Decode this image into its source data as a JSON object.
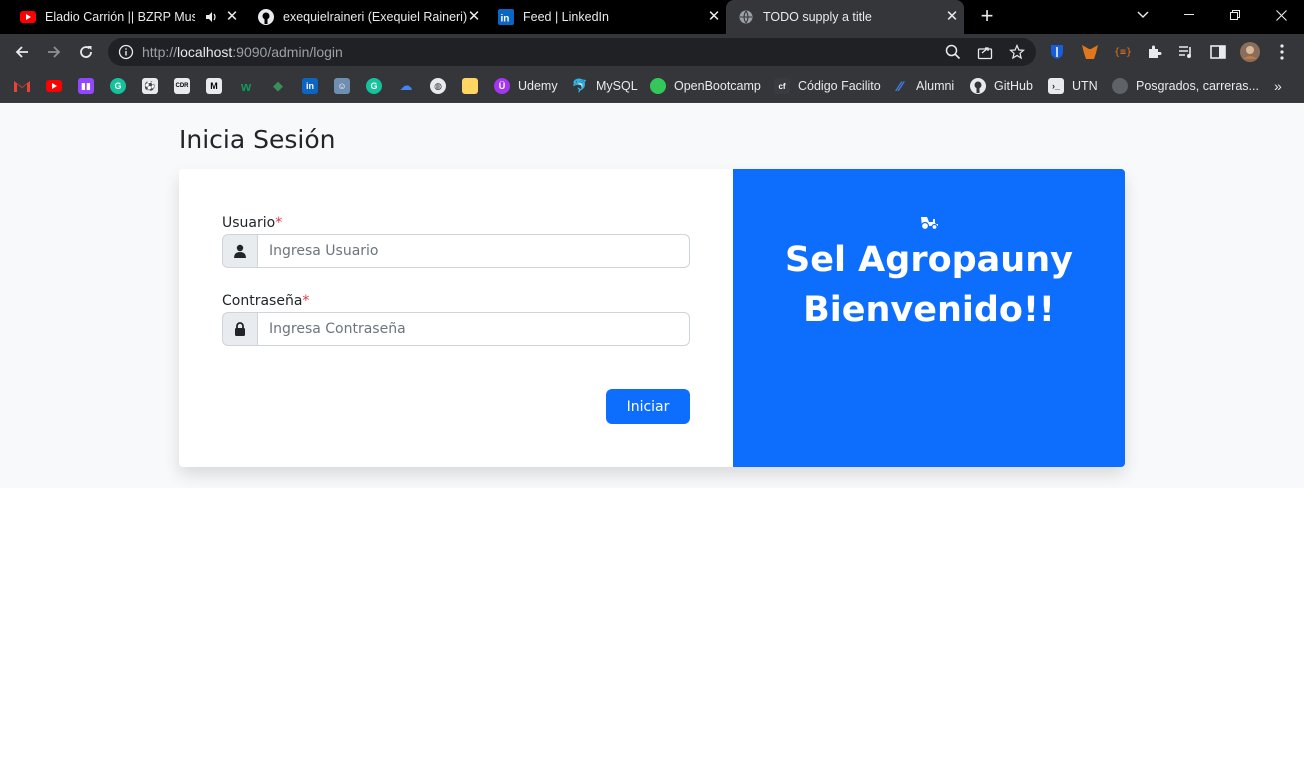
{
  "browser": {
    "tabs": [
      {
        "title": "Eladio Carrión || BZRP Music",
        "icon": "youtube-icon",
        "audio": true,
        "active": false
      },
      {
        "title": "exequielraineri (Exequiel Raineri)",
        "icon": "github-icon",
        "active": false
      },
      {
        "title": "Feed | LinkedIn",
        "icon": "linkedin-icon",
        "active": false
      },
      {
        "title": "TODO supply a title",
        "icon": "globe-icon",
        "active": true
      }
    ],
    "url_prefix": "http://",
    "url_host": "localhost",
    "url_rest": ":9090/admin/login",
    "bookmarks": [
      {
        "label": "",
        "icon": "gmail-icon",
        "color": "#ea4335"
      },
      {
        "label": "",
        "icon": "youtube-icon",
        "color": "#ff0000"
      },
      {
        "label": "",
        "icon": "twitch-icon",
        "color": "#9146ff"
      },
      {
        "label": "",
        "icon": "grammarly-icon",
        "color": "#15c39a"
      },
      {
        "label": "",
        "icon": "soccer-icon",
        "color": "#9aa0a6"
      },
      {
        "label": "",
        "icon": "coder-icon",
        "color": "#222222"
      },
      {
        "label": "",
        "icon": "medium-icon",
        "color": "#111111"
      },
      {
        "label": "",
        "icon": "w-icon",
        "color": "#0f9d58"
      },
      {
        "label": "",
        "icon": "ethereum-icon",
        "color": "#3c8c5c"
      },
      {
        "label": "",
        "icon": "linkedin-icon",
        "color": "#0a66c2"
      },
      {
        "label": "",
        "icon": "profile-icon",
        "color": "#6f8fb0"
      },
      {
        "label": "",
        "icon": "grammarly-icon",
        "color": "#15c39a"
      },
      {
        "label": "",
        "icon": "cloud-icon",
        "color": "#4285f4"
      },
      {
        "label": "",
        "icon": "globe-icon",
        "color": "#bdc1c6"
      },
      {
        "label": "",
        "icon": "note-icon",
        "color": "#fdd663"
      },
      {
        "label": "Udemy",
        "icon": "udemy-icon",
        "color": "#a435f0"
      },
      {
        "label": "MySQL",
        "icon": "mysql-icon",
        "color": "#4479a1"
      },
      {
        "label": "OpenBootcamp",
        "icon": "openbootcamp-icon",
        "color": "#34c759"
      },
      {
        "label": "Código Facilito",
        "icon": "codigofacilito-icon",
        "color": "#3a3b40"
      },
      {
        "label": "Alumni",
        "icon": "alumni-icon",
        "color": "#4285f4"
      },
      {
        "label": "GitHub",
        "icon": "github-icon",
        "color": "#ffffff"
      },
      {
        "label": "UTN",
        "icon": "terminal-icon",
        "color": "#202124"
      },
      {
        "label": "Posgrados, carreras...",
        "icon": "circle-icon",
        "color": "#5f6368"
      }
    ]
  },
  "page": {
    "heading": "Inicia Sesión",
    "user_label": "Usuario",
    "user_placeholder": "Ingresa Usuario",
    "password_label": "Contraseña",
    "password_placeholder": "Ingresa Contraseña",
    "required_mark": "*",
    "submit_label": "Iniciar",
    "brand_line1": "Sel Agropauny",
    "brand_line2": "Bienvenido!!",
    "accent_color": "#0d6efd"
  }
}
